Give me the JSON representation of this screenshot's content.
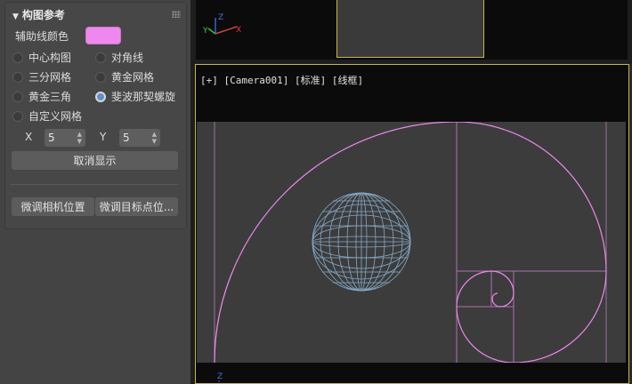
{
  "panel": {
    "title": "构图参考",
    "guide_color_label": "辅助线颜色",
    "guide_color": "#ee88ee",
    "options": [
      {
        "label": "中心构图",
        "selected": false
      },
      {
        "label": "对角线",
        "selected": false
      },
      {
        "label": "三分网格",
        "selected": false
      },
      {
        "label": "黄金网格",
        "selected": false
      },
      {
        "label": "黄金三角",
        "selected": false
      },
      {
        "label": "斐波那契螺旋",
        "selected": true
      },
      {
        "label": "自定义网格",
        "selected": false
      }
    ],
    "x_label": "X",
    "x_value": "5",
    "y_label": "Y",
    "y_value": "5",
    "cancel_display": "取消显示",
    "adjust_camera": "微调相机位置",
    "adjust_target": "微调目标点位..."
  },
  "viewport": {
    "label": "[+] [Camera001] [标准] [线框]",
    "sphere_color": "#86a9c9",
    "guide_color": "#ee88ee",
    "frame_color": "#c9b44a",
    "axis_labels": {
      "x": "X",
      "y": "Y",
      "z": "Z"
    }
  }
}
